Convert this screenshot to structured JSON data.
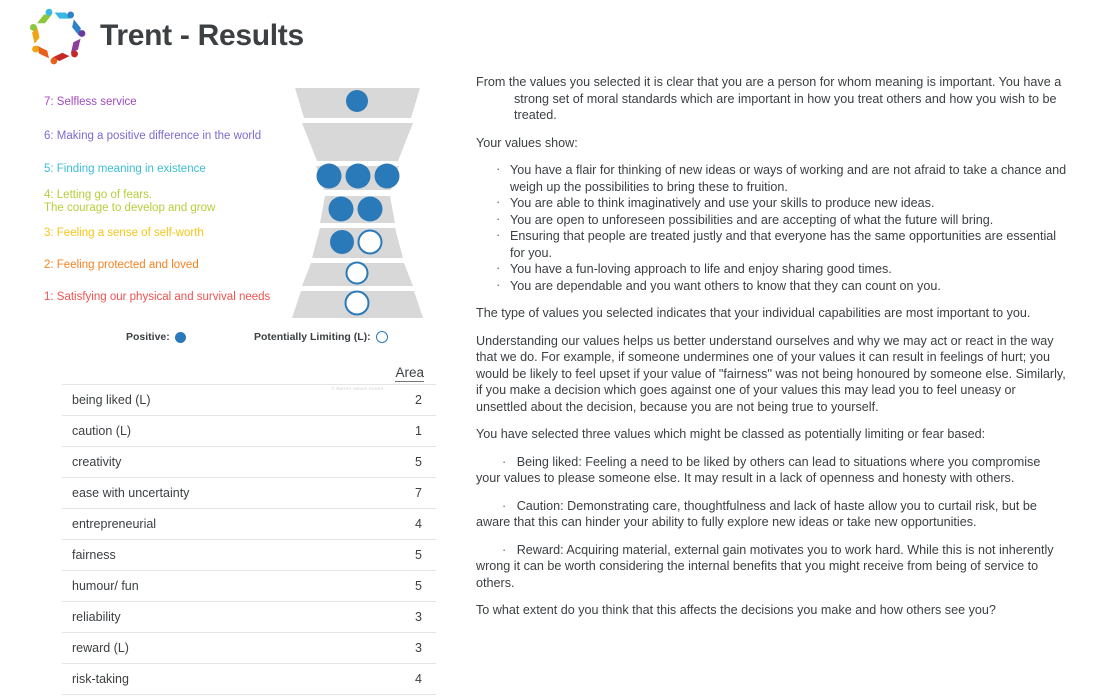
{
  "header": {
    "title": "Trent - Results",
    "logo_name": "collaboration-people-circle-logo"
  },
  "pyramid": {
    "levels": [
      {
        "num": "7",
        "label": "7: Selfless service",
        "color": "#a04bc0"
      },
      {
        "num": "6",
        "label": "6: Making a positive difference in the world",
        "color": "#7b6bd0"
      },
      {
        "num": "5",
        "label": "5: Finding meaning in existence",
        "color": "#3bbfd4"
      },
      {
        "num": "4",
        "label": "4: Letting go of fears.\nThe courage to develop and grow",
        "color": "#b5cf3a"
      },
      {
        "num": "3",
        "label": "3: Feeling a sense of self-worth",
        "color": "#f5c518"
      },
      {
        "num": "2",
        "label": "2: Feeling protected and loved",
        "color": "#f58220"
      },
      {
        "num": "1",
        "label": "1: Satisfying our physical and survival needs",
        "color": "#ef5350"
      }
    ],
    "credit": "© Barrett Values Centre",
    "legend": {
      "positive_label": "Positive:",
      "limiting_label": "Potentially Limiting (L):"
    },
    "marker_colors": {
      "positive_fill": "#2a7ab9",
      "limiting_stroke": "#2a7ab9",
      "band_fill": "#d8d8d8"
    },
    "markers": [
      {
        "level": 7,
        "positive": 1,
        "limiting": 0
      },
      {
        "level": 6,
        "positive": 0,
        "limiting": 0
      },
      {
        "level": 5,
        "positive": 3,
        "limiting": 0
      },
      {
        "level": 4,
        "positive": 2,
        "limiting": 0
      },
      {
        "level": 3,
        "positive": 1,
        "limiting": 1
      },
      {
        "level": 2,
        "positive": 0,
        "limiting": 1
      },
      {
        "level": 1,
        "positive": 0,
        "limiting": 1
      }
    ]
  },
  "chart_data": {
    "type": "table",
    "title": "",
    "columns": [
      "",
      "Area"
    ],
    "categories": [
      "being liked (L)",
      "caution (L)",
      "creativity",
      "ease with uncertainty",
      "entrepreneurial",
      "fairness",
      "humour/ fun",
      "reliability",
      "reward (L)",
      "risk-taking"
    ],
    "values": [
      2,
      1,
      5,
      7,
      4,
      5,
      5,
      3,
      3,
      4
    ]
  },
  "table": {
    "header_area": "Area",
    "rows": [
      {
        "name": "being liked (L)",
        "area": "2"
      },
      {
        "name": "caution (L)",
        "area": "1"
      },
      {
        "name": "creativity",
        "area": "5"
      },
      {
        "name": "ease with uncertainty",
        "area": "7"
      },
      {
        "name": "entrepreneurial",
        "area": "4"
      },
      {
        "name": "fairness",
        "area": "5"
      },
      {
        "name": "humour/ fun",
        "area": "5"
      },
      {
        "name": "reliability",
        "area": "3"
      },
      {
        "name": "reward (L)",
        "area": "3"
      },
      {
        "name": "risk-taking",
        "area": "4"
      }
    ]
  },
  "report": {
    "intro_line1": "From the values you selected it is clear that you are a person for whom meaning is important. You have a",
    "intro_line2": "strong set of moral standards which are important in how you treat others and how you wish to be treated.",
    "values_show_heading": "Your values show:",
    "bullets": [
      "You have a flair for thinking of new ideas or ways of working and are not afraid to take a chance and weigh up the possibilities to bring these to fruition.",
      "You are able to think imaginatively and use your skills to produce new ideas.",
      "You are open to unforeseen possibilities and are accepting of what the future will bring.",
      "Ensuring that people are treated justly and that everyone has the same opportunities are essential for you.",
      "You have a fun-loving approach to life and enjoy sharing good times.",
      "You are dependable and you want others to know that they can count on you."
    ],
    "type_of_values": "The type of values you selected indicates that your individual capabilities are most important to you.",
    "understanding": "Understanding our values helps us better understand ourselves and why we may act or react in the way that we do. For example, if someone undermines one of your values it can result in feelings of hurt; you would be likely to feel upset if your value of \"fairness\" was not being honoured by someone else. Similarly, if you make a decision which goes against one of your values this may lead you to feel uneasy or unsettled about the decision, because you are not being true to yourself.",
    "limiting_heading": "You have selected three values which might be classed as potentially limiting or fear based:",
    "limiting_items": [
      "Being liked: Feeling a need to be liked by others can lead to situations where you compromise your values to please someone else. It may result in a lack of openness and honesty with others.",
      "Caution: Demonstrating care, thoughtfulness and lack of haste allow you to curtail risk, but be aware that this can hinder your ability to fully explore new ideas or take new opportunities.",
      "Reward: Acquiring material, external gain motivates you to work hard. While this is not inherently wrong it can be worth considering the internal benefits that you might receive from being of service to others."
    ],
    "closing_question": "To what extent do you think that this affects the decisions you make and how others see you?"
  }
}
